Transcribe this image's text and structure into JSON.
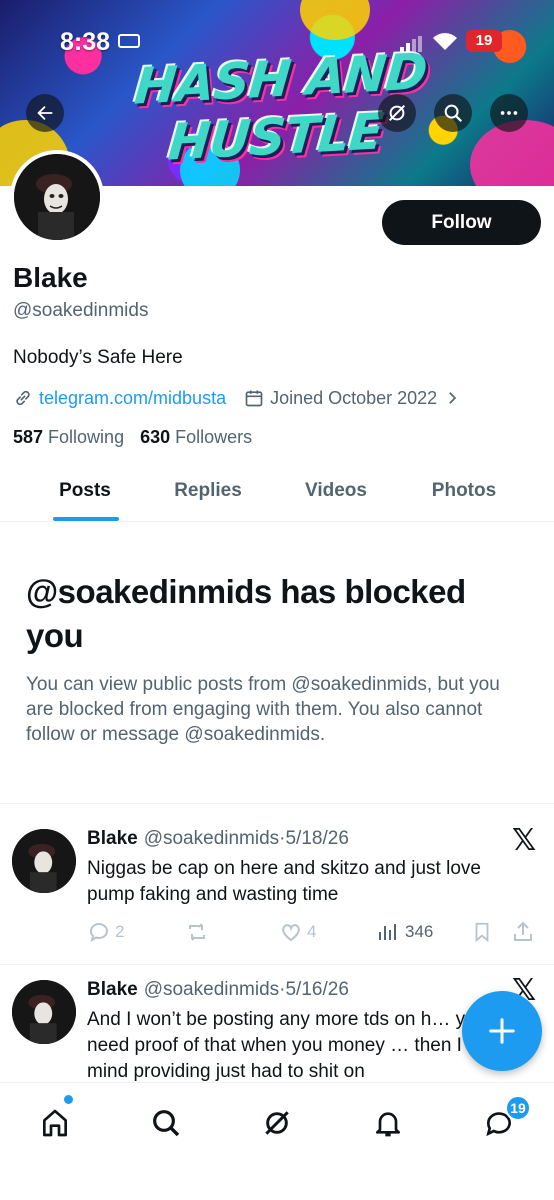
{
  "status_bar": {
    "time": "8:38",
    "battery": "19"
  },
  "banner": {
    "title": "HASH AND HUSTLE"
  },
  "profile": {
    "display_name": "Blake",
    "handle": "@soakedinmids",
    "bio": "Nobody’s Safe Here",
    "link": "telegram.com/midbusta",
    "joined": "Joined October 2022",
    "following_count": "587",
    "following_label": "Following",
    "followers_count": "630",
    "followers_label": "Followers",
    "follow_button": "Follow"
  },
  "tabs": [
    "Posts",
    "Replies",
    "Videos",
    "Photos"
  ],
  "blocked_notice": {
    "title": "@soakedinmids has blocked you",
    "body": "You can view public posts from @soakedinmids, but you are blocked from engaging with them. You also cannot follow or message @soakedinmids."
  },
  "posts": [
    {
      "name": "Blake",
      "handle_date": "@soakedinmids·5/18/26",
      "text": "Niggas be cap on here and skitzo and just love pump faking and wasting time",
      "replies": "2",
      "reposts": "",
      "likes": "4",
      "views": "346"
    },
    {
      "name": "Blake",
      "handle_date": "@soakedinmids·5/16/26",
      "text": "And I won’t be posting any more tds on h… you need proof of that when you money … then I won’t mind providing just had to shit on"
    }
  ],
  "post_logo": "𝕏",
  "bottom_nav": {
    "messages_badge": "19"
  },
  "colors": {
    "accent": "#1d9bf0",
    "text": "#0f1419",
    "secondary": "#536471"
  }
}
